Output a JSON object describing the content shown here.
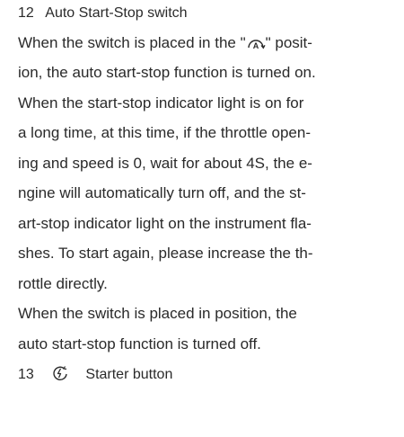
{
  "section12": {
    "number": "12",
    "title": "Auto Start-Stop switch",
    "icon": "auto-start-stop-icon",
    "para1": {
      "line1_pre": "When the switch is placed in the \"",
      "line1_post": "\" posit-",
      "line2": "ion, the auto start-stop function is turned on.",
      "line3": "When the start-stop indicator light is on for",
      "line4": "a long time, at this time, if the throttle open-",
      "line5": "ing and speed is 0, wait for about 4S, the e-",
      "line6": "ngine will automatically turn off, and the st-",
      "line7": "art-stop indicator light on the instrument fla-",
      "line8": "shes. To start again, please increase the th-",
      "line9": "rottle directly."
    },
    "para2": {
      "line1": "When the switch is placed in position, the",
      "line2": "auto start-stop function is turned off."
    }
  },
  "section13": {
    "number": "13",
    "icon": "starter-button-icon",
    "title": "Starter button"
  }
}
